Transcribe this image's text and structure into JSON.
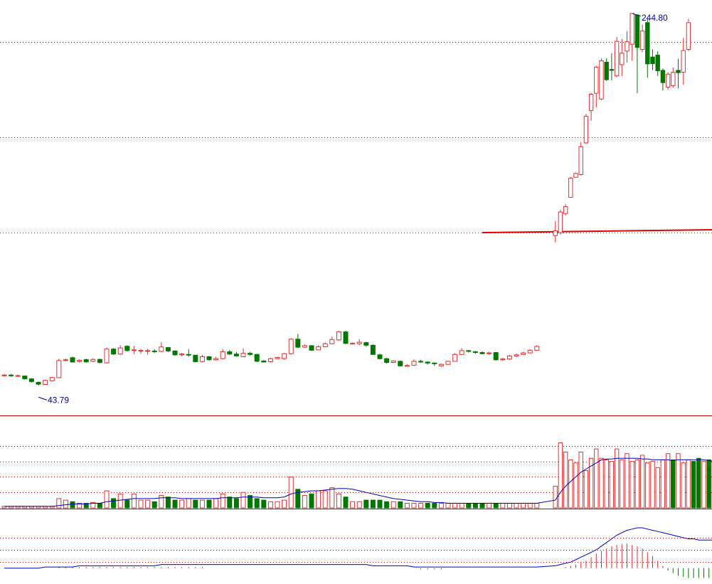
{
  "colors": {
    "up": "#e03030",
    "down": "#007800",
    "grid": "#b02020",
    "divider": "#c00000",
    "ma_line": "#0000c0",
    "annotation": "#0000a0",
    "support_line": "#e00000",
    "macd_up": "#e03030",
    "macd_down": "#007800"
  },
  "annotations": {
    "low_label": "43.79",
    "high_label": "244.80"
  },
  "chart_data": [
    {
      "type": "candlestick",
      "title": "",
      "price_range": [
        35,
        250
      ],
      "grid_levels": [
        130,
        180,
        230
      ],
      "low": 43.79,
      "high": 244.8,
      "support_line": {
        "from_index": 76,
        "start": 130.0,
        "end": 131.5
      },
      "candles": [
        [
          55.0,
          55.4,
          56.0,
          54.6
        ],
        [
          55.4,
          55.0,
          56.0,
          54.5
        ],
        [
          55.0,
          55.1,
          55.7,
          54.5
        ],
        [
          54.9,
          53.4,
          55.2,
          53.0
        ],
        [
          53.4,
          52.0,
          53.8,
          51.5
        ],
        [
          51.6,
          50.6,
          52.0,
          49.9
        ],
        [
          50.5,
          52.6,
          53.0,
          50.2
        ],
        [
          52.4,
          54.1,
          54.5,
          52.0
        ],
        [
          54.0,
          63.0,
          64.0,
          53.8
        ],
        [
          63.0,
          63.4,
          64.0,
          62.6
        ],
        [
          64.5,
          62.2,
          65.0,
          62.0
        ],
        [
          62.5,
          63.1,
          63.6,
          62.0
        ],
        [
          63.5,
          62.3,
          64.0,
          61.8
        ],
        [
          62.6,
          63.6,
          64.2,
          62.2
        ],
        [
          63.6,
          62.0,
          64.0,
          61.5
        ],
        [
          61.8,
          69.0,
          69.8,
          61.5
        ],
        [
          69.0,
          66.4,
          69.5,
          66.0
        ],
        [
          66.4,
          69.6,
          71.0,
          66.0
        ],
        [
          70.5,
          68.2,
          71.0,
          67.8
        ],
        [
          68.2,
          68.6,
          70.5,
          66.5
        ],
        [
          68.2,
          68.3,
          69.0,
          66.5
        ],
        [
          68.0,
          68.2,
          69.2,
          66.0
        ],
        [
          68.0,
          67.8,
          69.0,
          66.8
        ],
        [
          67.8,
          70.1,
          72.6,
          67.4
        ],
        [
          69.8,
          68.0,
          70.0,
          67.5
        ],
        [
          68.0,
          66.0,
          68.4,
          65.4
        ],
        [
          66.0,
          66.4,
          67.0,
          65.2
        ],
        [
          66.2,
          66.0,
          69.0,
          65.0
        ],
        [
          65.8,
          62.4,
          66.0,
          62.0
        ],
        [
          62.5,
          65.0,
          66.0,
          62.0
        ],
        [
          65.0,
          63.4,
          65.5,
          63.0
        ],
        [
          63.4,
          64.0,
          65.0,
          63.0
        ],
        [
          64.0,
          67.6,
          69.0,
          63.5
        ],
        [
          67.6,
          66.4,
          68.6,
          65.8
        ],
        [
          66.4,
          65.4,
          67.5,
          65.0
        ],
        [
          65.0,
          66.8,
          69.4,
          64.8
        ],
        [
          66.8,
          66.2,
          67.6,
          65.6
        ],
        [
          66.2,
          62.6,
          66.5,
          62.2
        ],
        [
          62.8,
          62.2,
          63.2,
          62.0
        ],
        [
          62.4,
          64.0,
          64.5,
          62.0
        ],
        [
          64.0,
          64.6,
          65.0,
          63.8
        ],
        [
          64.0,
          66.6,
          67.0,
          63.4
        ],
        [
          66.6,
          74.2,
          74.8,
          66.0
        ],
        [
          74.2,
          70.0,
          77.0,
          69.5
        ],
        [
          70.0,
          70.8,
          71.5,
          69.6
        ],
        [
          70.8,
          68.4,
          71.0,
          68.0
        ],
        [
          68.6,
          70.2,
          71.0,
          68.4
        ],
        [
          70.2,
          71.8,
          72.5,
          70.0
        ],
        [
          71.8,
          74.0,
          75.5,
          71.5
        ],
        [
          73.8,
          78.0,
          78.6,
          73.4
        ],
        [
          78.0,
          72.0,
          78.6,
          71.5
        ],
        [
          72.0,
          72.0,
          72.5,
          71.6
        ],
        [
          71.8,
          72.6,
          74.2,
          71.0
        ],
        [
          72.4,
          71.0,
          72.8,
          70.2
        ],
        [
          71.0,
          66.2,
          71.5,
          66.0
        ],
        [
          66.0,
          64.0,
          66.6,
          63.5
        ],
        [
          64.0,
          62.0,
          64.4,
          61.4
        ],
        [
          62.0,
          62.8,
          63.2,
          61.8
        ],
        [
          62.6,
          60.2,
          63.0,
          60.0
        ],
        [
          60.0,
          60.4,
          61.2,
          59.8
        ],
        [
          60.5,
          62.6,
          63.6,
          60.2
        ],
        [
          62.6,
          62.3,
          63.4,
          61.8
        ],
        [
          62.2,
          61.7,
          62.6,
          60.8
        ],
        [
          61.7,
          61.4,
          62.0,
          60.2
        ],
        [
          60.2,
          61.0,
          61.5,
          59.8
        ],
        [
          61.0,
          62.6,
          63.0,
          60.8
        ],
        [
          62.6,
          66.2,
          67.0,
          62.4
        ],
        [
          66.2,
          68.2,
          69.5,
          66.0
        ],
        [
          68.2,
          67.8,
          68.6,
          67.2
        ],
        [
          67.6,
          67.2,
          68.0,
          66.6
        ],
        [
          67.2,
          66.6,
          67.8,
          66.2
        ],
        [
          66.6,
          67.0,
          67.6,
          66.0
        ],
        [
          67.2,
          63.4,
          67.5,
          63.0
        ],
        [
          63.4,
          63.8,
          64.4,
          62.8
        ],
        [
          63.8,
          65.4,
          66.0,
          63.2
        ],
        [
          65.4,
          66.0,
          66.6,
          65.0
        ],
        [
          66.2,
          67.0,
          67.6,
          66.0
        ],
        [
          67.0,
          68.4,
          69.0,
          66.8
        ],
        [
          68.4,
          70.4,
          71.0,
          68.2
        ],
        [
          128.4,
          131.0,
          136.0,
          124.9
        ],
        [
          130.0,
          140.8,
          142.0,
          129.0
        ],
        [
          140.0,
          143.6,
          145.0,
          139.0
        ],
        [
          148.5,
          158.6,
          159.2,
          148.5
        ],
        [
          159.0,
          161.0,
          161.5,
          158.8
        ],
        [
          160.4,
          175.0,
          177.5,
          159.9
        ],
        [
          177.0,
          191.0,
          192.2,
          176.4
        ],
        [
          194.0,
          202.5,
          203.2,
          188.6
        ],
        [
          203.0,
          216.7,
          217.3,
          195.6
        ],
        [
          200.0,
          220.0,
          221.2,
          199.4
        ],
        [
          219.3,
          210.1,
          221.3,
          209.4
        ],
        [
          215.5,
          215.0,
          224.0,
          209.8
        ],
        [
          212.1,
          230.2,
          232.5,
          211.4
        ],
        [
          218.0,
          224.0,
          231.5,
          212.0
        ],
        [
          225.1,
          230.0,
          235.5,
          219.0
        ],
        [
          228.7,
          244.8,
          244.8,
          220.0
        ],
        [
          244.0,
          227.0,
          244.5,
          203.0
        ],
        [
          226.0,
          235.6,
          239.0,
          224.5
        ],
        [
          240.0,
          218.4,
          242.0,
          211.2
        ],
        [
          222.0,
          218.5,
          226.0,
          215.0
        ],
        [
          223.0,
          214.8,
          225.0,
          212.0
        ],
        [
          215.0,
          208.6,
          216.0,
          204.5
        ],
        [
          206.2,
          213.0,
          214.0,
          205.0
        ],
        [
          207.0,
          214.0,
          216.5,
          206.0
        ],
        [
          215.0,
          213.8,
          221.0,
          205.5
        ],
        [
          214.0,
          225.4,
          232.0,
          207.5
        ],
        [
          226.0,
          240.0,
          242.0,
          225.0
        ]
      ]
    },
    {
      "type": "bar",
      "title": "",
      "series_kind": "volume",
      "ylim": [
        0,
        100
      ],
      "grid_levels": [
        20,
        40,
        60,
        80
      ],
      "values": [
        2,
        2,
        2,
        2,
        2,
        2,
        2,
        2,
        12,
        10,
        8,
        6,
        6,
        7,
        6,
        22,
        12,
        18,
        10,
        18,
        10,
        10,
        8,
        16,
        14,
        10,
        10,
        12,
        10,
        10,
        10,
        12,
        18,
        14,
        12,
        20,
        16,
        12,
        10,
        8,
        8,
        10,
        40,
        24,
        16,
        18,
        22,
        22,
        26,
        18,
        14,
        8,
        8,
        10,
        10,
        10,
        8,
        8,
        8,
        6,
        6,
        6,
        6,
        6,
        6,
        6,
        6,
        6,
        6,
        6,
        6,
        6,
        6,
        6,
        6,
        6,
        6,
        6,
        6,
        28,
        84,
        72,
        62,
        58,
        72,
        48,
        64,
        76,
        64,
        62,
        60,
        76,
        62,
        70,
        60,
        62,
        68,
        58,
        60,
        52,
        62,
        70,
        62,
        70,
        58,
        62,
        60,
        64,
        60,
        62,
        58,
        52,
        60,
        64,
        78,
        84,
        78
      ],
      "colors_up": [
        1,
        1,
        1,
        1,
        1,
        1,
        1,
        1,
        1,
        1,
        0,
        1,
        0,
        1,
        0,
        1,
        0,
        1,
        0,
        1,
        1,
        1,
        0,
        1,
        0,
        0,
        1,
        1,
        0,
        1,
        0,
        1,
        1,
        0,
        0,
        1,
        0,
        0,
        0,
        1,
        1,
        1,
        1,
        0,
        1,
        0,
        1,
        1,
        1,
        1,
        0,
        1,
        1,
        0,
        0,
        0,
        0,
        1,
        0,
        1,
        1,
        1,
        0,
        0,
        1,
        1,
        1,
        1,
        0,
        0,
        0,
        1,
        0,
        1,
        1,
        1,
        1,
        1,
        1,
        1,
        1,
        1,
        1,
        1,
        1,
        1,
        1,
        1,
        1,
        1,
        1,
        1,
        1,
        1,
        1,
        1,
        1,
        1,
        1,
        1,
        1,
        1,
        0,
        1,
        1,
        1,
        0,
        0,
        1,
        0,
        1,
        1,
        0,
        1,
        1,
        1,
        1
      ],
      "ma": [
        2,
        2,
        2,
        2,
        2,
        2,
        2,
        2,
        3,
        4,
        5,
        5,
        5,
        6,
        6,
        8,
        9,
        10,
        11,
        12,
        12,
        12,
        12,
        13,
        13,
        13,
        12,
        12,
        12,
        12,
        12,
        12,
        13,
        13,
        13,
        14,
        14,
        14,
        13,
        13,
        13,
        14,
        18,
        20,
        21,
        22,
        22,
        23,
        24,
        25,
        25,
        24,
        22,
        20,
        18,
        16,
        14,
        12,
        11,
        10,
        9,
        8,
        8,
        7,
        7,
        6,
        6,
        6,
        6,
        6,
        6,
        6,
        6,
        6,
        6,
        6,
        6,
        6,
        6,
        10,
        20,
        28,
        34,
        40,
        46,
        50,
        54,
        58,
        62,
        63,
        63,
        64,
        64,
        64,
        64,
        64,
        63,
        63,
        62,
        62,
        62,
        62,
        61,
        62,
        62,
        62,
        62,
        62,
        62,
        61,
        60,
        60,
        60,
        61,
        62,
        64,
        66
      ]
    },
    {
      "type": "bar",
      "title": "",
      "series_kind": "macd",
      "ylim": [
        -10,
        40
      ],
      "bars": [
        0,
        0,
        0,
        0,
        0,
        0,
        0,
        0,
        1,
        1,
        1,
        1,
        1,
        1,
        1,
        1,
        1,
        1,
        1,
        1,
        1,
        1,
        1,
        1,
        1,
        1,
        1,
        1,
        1,
        1,
        0,
        0,
        0,
        0,
        0,
        0,
        0,
        0,
        0,
        0,
        0,
        0,
        0,
        0,
        0,
        0,
        0,
        0,
        0,
        0,
        0,
        0,
        0,
        0,
        0,
        0,
        0,
        0,
        0,
        0,
        0,
        -1,
        -1,
        -1,
        -1,
        0,
        0,
        0,
        0,
        0,
        0,
        0,
        0,
        0,
        0,
        0,
        0,
        0,
        0,
        0,
        0,
        1,
        2,
        3,
        5,
        6,
        9,
        12,
        14,
        16,
        18,
        19,
        20,
        20,
        19,
        18,
        16,
        13,
        10,
        6,
        2,
        -2,
        -4,
        -6,
        -7,
        -8,
        -8,
        -8,
        -8,
        -8,
        -8,
        -8,
        -8,
        -8,
        -8,
        -8,
        -8,
        -8,
        -8
      ],
      "line": [
        0,
        0,
        0,
        0,
        0,
        0,
        1,
        1,
        1,
        1,
        1,
        2,
        2,
        2,
        2,
        2,
        2,
        2,
        2,
        2,
        2,
        2,
        2,
        3,
        3,
        3,
        3,
        3,
        3,
        3,
        3,
        3,
        3,
        3,
        3,
        3,
        3,
        3,
        3,
        3,
        3,
        3,
        3,
        3,
        3,
        3,
        3,
        3,
        3,
        3,
        3,
        3,
        3,
        3,
        2,
        2,
        2,
        2,
        2,
        2,
        1,
        1,
        1,
        1,
        1,
        1,
        1,
        1,
        1,
        1,
        1,
        1,
        1,
        1,
        1,
        1,
        1,
        1,
        1,
        2,
        3,
        4,
        5,
        7,
        9,
        11,
        13,
        15,
        18,
        21,
        24,
        27,
        29,
        31,
        32,
        33,
        33,
        32,
        31,
        30,
        29,
        28,
        27,
        26,
        25,
        24,
        24,
        23,
        23,
        23,
        23,
        23,
        23,
        23,
        23,
        23,
        23
      ]
    }
  ]
}
